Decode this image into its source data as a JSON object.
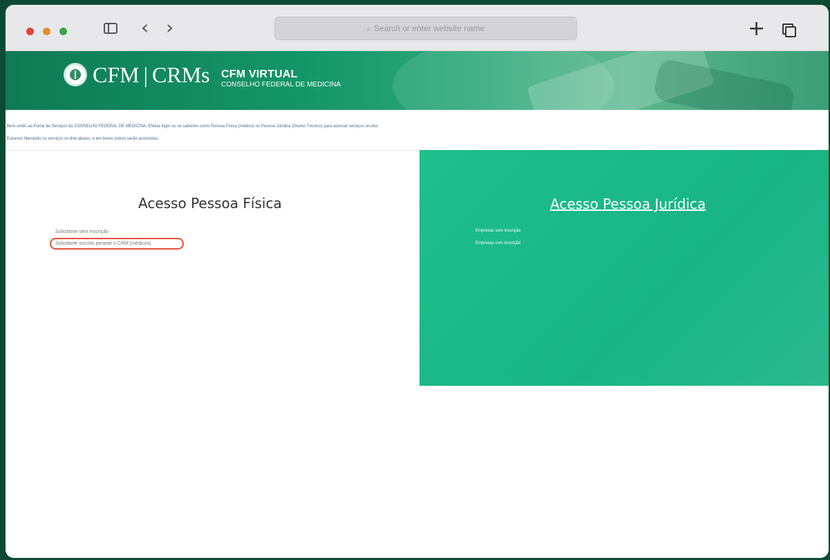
{
  "browser": {
    "url_placeholder": "Search or enter website name"
  },
  "banner": {
    "logo_cfm": "CFM",
    "logo_separator": "|",
    "logo_crms": "CRMs",
    "brand_title": "CFM VIRTUAL",
    "brand_subtitle": "CONSELHO FEDERAL DE MEDICINA"
  },
  "intro": {
    "line1": "Bem-vindo ao Portal de Serviços do CONSELHO FEDERAL DE MEDICINA. Efetue login ou se cadastre como Pessoa Física (médico) ou Pessoa Jurídica (Diretor Técnico) para acessar serviços on-line.",
    "line2": "Estamos liberando os serviços on-line abaixo, e em breve outros serão acrescidos."
  },
  "pessoa_fisica": {
    "title": "Acesso Pessoa Física",
    "links": [
      "Solicitante sem inscrição",
      "Solicitante inscrito perante o CRM (médicos)"
    ]
  },
  "pessoa_juridica": {
    "title": "Acesso Pessoa Jurídica",
    "links": [
      "Empresas sem inscrição",
      "Empresas com inscrição"
    ]
  },
  "colors": {
    "brand_green": "#1ec08d",
    "highlight_ring": "#e3513c"
  }
}
